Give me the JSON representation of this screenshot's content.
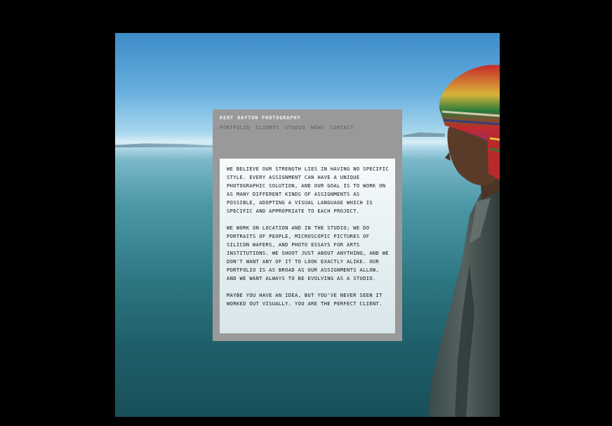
{
  "site": {
    "title": "KENT DAYTON PHOTOGRAPHY"
  },
  "nav": {
    "items": [
      {
        "label": "PORTFOLIO"
      },
      {
        "label": "CLIENTS"
      },
      {
        "label": "STUDIO"
      },
      {
        "label": "NEWS"
      },
      {
        "label": "CONTACT"
      }
    ]
  },
  "content": {
    "paragraphs": [
      "WE BELIEVE OUR STRENGTH LIES IN HAVING NO SPECIFIC STYLE. EVERY ASSIGNMENT CAN HAVE A UNIQUE PHOTOGRAPHIC SOLUTION, AND OUR GOAL IS TO WORK ON AS MANY DIFFERENT KINDS OF ASSIGNMENTS AS POSSIBLE, ADOPTING A VISUAL LANGUAGE WHICH IS SPECIFIC AND APPROPRIATE TO EACH PROJECT.",
      "WE WORK ON LOCATION AND IN THE STUDIO; WE DO PORTRAITS OF PEOPLE, MICROSCOPIC PICTURES OF SILICON WAFERS, AND PHOTO ESSAYS FOR ARTS INSTITUTIONS. WE SHOOT JUST ABOUT ANYTHING, AND WE DON'T WANT ANY OF IT TO LOOK EXACTLY ALIKE. OUR PORTFOLIO IS AS BROAD AS OUR ASSIGNMENTS ALLOW, AND WE WANT ALWAYS TO BE EVOLVING AS A STUDIO.",
      "MAYBE YOU HAVE AN IDEA, BUT YOU'VE NEVER SEEN IT WORKED OUT VISUALLY. YOU ARE THE PERFECT CLIENT."
    ]
  },
  "colors": {
    "page_background": "#000000",
    "panel": "#999999",
    "nav_text": "#5c5c5c",
    "title_text": "#f2f2f2"
  }
}
